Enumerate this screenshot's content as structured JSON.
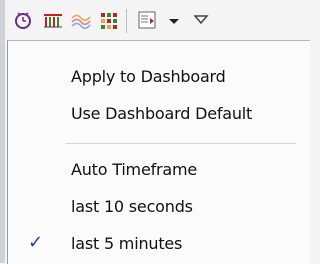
{
  "toolbar": {
    "icons": [
      "clock-icon",
      "bar-chart-icon",
      "line-chart-icon",
      "grid-chart-icon",
      "timeframe-icon",
      "dropdown-arrow-icon",
      "view-menu-icon"
    ]
  },
  "menu": {
    "items": [
      {
        "label": "Apply to Dashboard",
        "checked": false
      },
      {
        "label": "Use Dashboard Default",
        "checked": false
      },
      {
        "label": "Auto Timeframe",
        "checked": false
      },
      {
        "label": "last 10 seconds",
        "checked": false
      },
      {
        "label": "last 5 minutes",
        "checked": true
      }
    ],
    "check_glyph": "✓"
  },
  "colors": {
    "check": "#1f3fb0",
    "menu_bg": "#fbfbfb",
    "toolbar_bg": "#f4f4f4"
  }
}
